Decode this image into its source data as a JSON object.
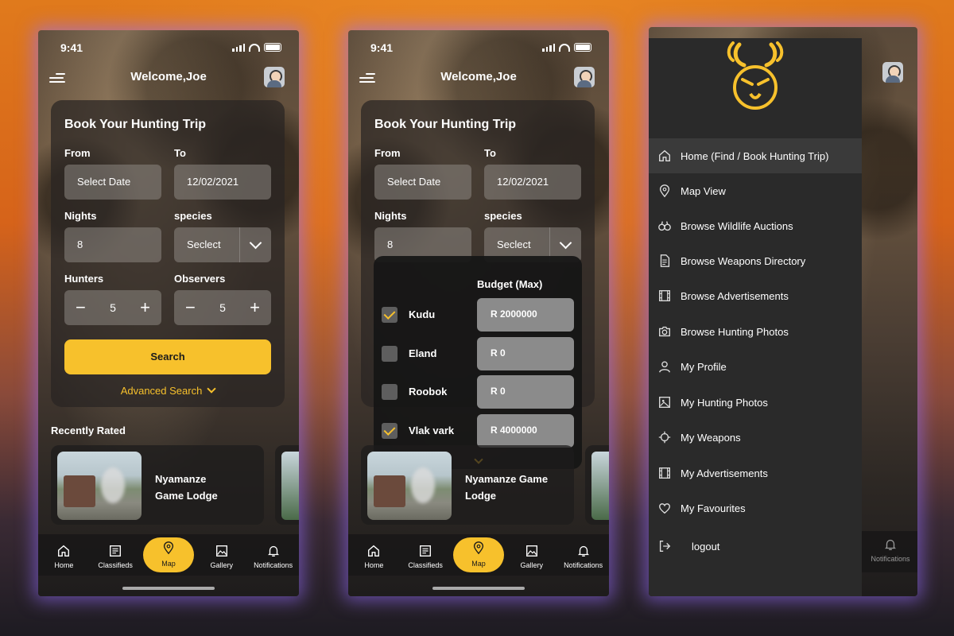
{
  "status_time": "9:41",
  "header": {
    "welcome": "Welcome,Joe"
  },
  "booking": {
    "title": "Book Your Hunting Trip",
    "from_label": "From",
    "to_label": "To",
    "from_placeholder": "Select Date",
    "to_value": "12/02/2021",
    "nights_label": "Nights",
    "nights_value": "8",
    "species_label": "species",
    "species_value": "Seclect",
    "hunters_label": "Hunters",
    "hunters_value": "5",
    "observers_label": "Observers",
    "observers_value": "5",
    "search_label": "Search",
    "advanced_label": "Advanced Search"
  },
  "recent": {
    "title": "Recently Rated",
    "item_name": "Nyamanze Game Lodge",
    "item_name_line1": "Nyamanze",
    "item_name_line2": "Game Lodge",
    "item_name_alt_line1": "Nyamanze Game",
    "item_name_alt_line2": "Lodge"
  },
  "species_dropdown": {
    "budget_title": "Budget (Max)",
    "rows": [
      {
        "name": "Kudu",
        "checked": true,
        "budget": "R 2000000"
      },
      {
        "name": "Eland",
        "checked": false,
        "budget": "R 0"
      },
      {
        "name": "Roobok",
        "checked": false,
        "budget": "R 0"
      },
      {
        "name": "Vlak vark",
        "checked": true,
        "budget": "R 4000000"
      }
    ]
  },
  "nav": [
    {
      "label": "Home",
      "icon": "home-icon",
      "active": false
    },
    {
      "label": "Classifieds",
      "icon": "classifieds-icon",
      "active": false
    },
    {
      "label": "Map",
      "icon": "map-pin-icon",
      "active": true
    },
    {
      "label": "Gallery",
      "icon": "gallery-icon",
      "active": false
    },
    {
      "label": "Notifications",
      "icon": "bell-icon",
      "active": false
    }
  ],
  "drawer": {
    "items": [
      {
        "label": "Home (Find / Book Hunting Trip)",
        "icon": "home-icon"
      },
      {
        "label": "Map View",
        "icon": "map-pin-icon"
      },
      {
        "label": "Browse Wildlife Auctions",
        "icon": "binoculars-icon"
      },
      {
        "label": "Browse Weapons Directory",
        "icon": "document-icon"
      },
      {
        "label": "Browse Advertisements",
        "icon": "film-icon"
      },
      {
        "label": "Browse Hunting Photos",
        "icon": "camera-icon"
      },
      {
        "label": "My Profile",
        "icon": "user-icon"
      },
      {
        "label": "My Hunting Photos",
        "icon": "image-icon"
      },
      {
        "label": "My Weapons",
        "icon": "crosshair-icon"
      },
      {
        "label": "My Advertisements",
        "icon": "film-icon"
      },
      {
        "label": "My Favourites",
        "icon": "heart-icon"
      },
      {
        "label": "logout",
        "icon": "logout-icon"
      }
    ],
    "behind_nav_label": "Notifications"
  },
  "colors": {
    "accent": "#f7c12c",
    "panel": "#2a2a2a"
  }
}
